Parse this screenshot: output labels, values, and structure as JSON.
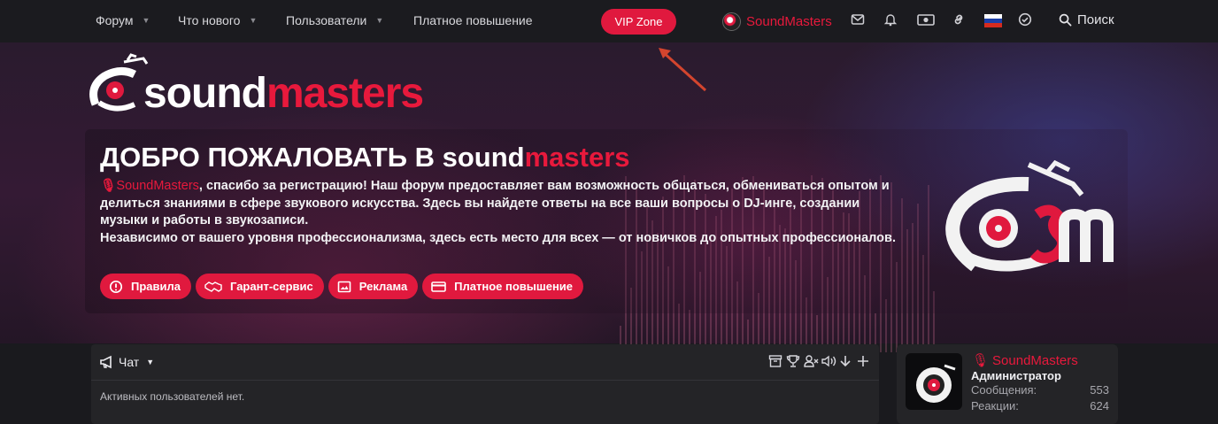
{
  "nav": {
    "forum": "Форум",
    "whats_new": "Что нового",
    "users": "Пользователи",
    "paid_boost": "Платное повышение",
    "vip": "VIP Zone",
    "username": "SoundMasters",
    "search": "Поиск",
    "icons": [
      "envelope-icon",
      "bell-icon",
      "money-icon",
      "link-icon",
      "russia-flag-icon",
      "check-circle-icon",
      "search-icon"
    ]
  },
  "logo": {
    "part1": "sound",
    "part2": "masters"
  },
  "welcome": {
    "title_part1": "ДОБРО ПОЖАЛОВАТЬ В sound",
    "title_part2": "masters",
    "username": "SoundMasters",
    "line1": ", спасибо за регистрацию! Наш форум предоставляет вам возможность общаться, обмениваться опытом и делиться знаниями в сфере звукового искусства. Здесь вы найдете ответы на все ваши вопросы о DJ-инге, создании музыки и работы в звукозаписи.",
    "line2": "Независимо от вашего уровня профессионализма, здесь есть место для всех — от новичков до опытных профессионалов.",
    "buttons": [
      "Правила",
      "Гарант-сервис",
      "Реклама",
      "Платное повышение"
    ]
  },
  "chat": {
    "title": "Чат",
    "empty": "Активных пользователей нет."
  },
  "profile": {
    "name": "SoundMasters",
    "role": "Администратор",
    "stats": [
      {
        "label": "Сообщения:",
        "value": "553"
      },
      {
        "label": "Реакции:",
        "value": "624"
      }
    ]
  },
  "colors": {
    "accent": "#e0193e",
    "background": "#1a1a1e",
    "panel": "#242427"
  }
}
